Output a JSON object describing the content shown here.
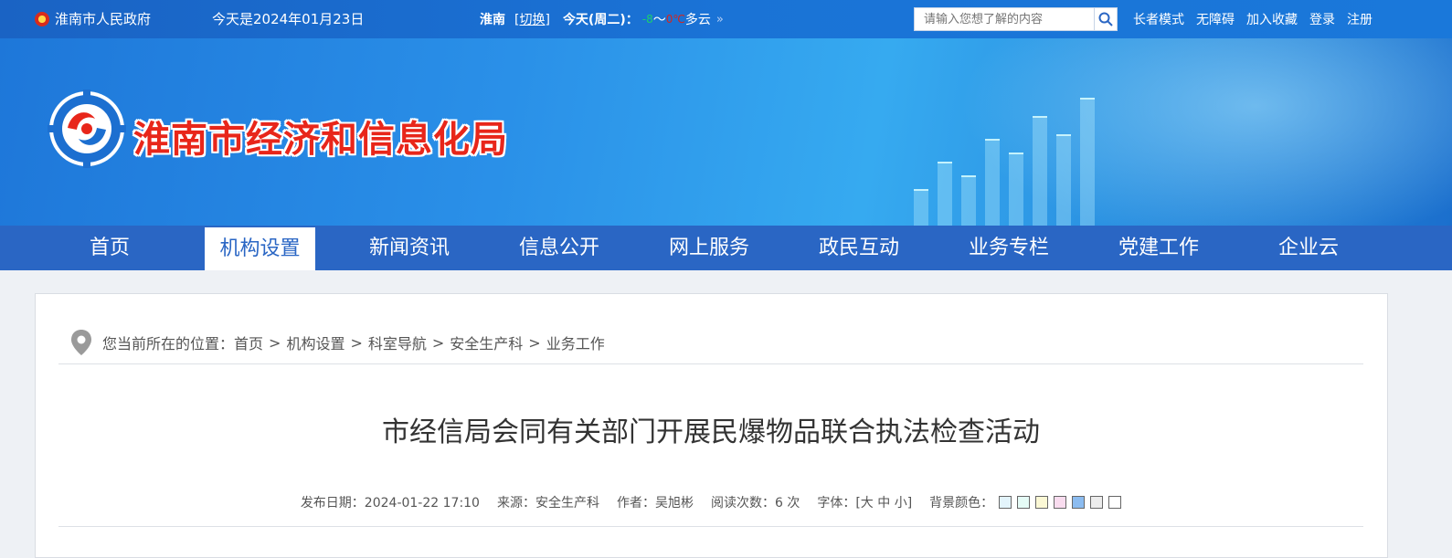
{
  "topbar": {
    "gov_name": "淮南市人民政府",
    "date_text": "今天是2024年01月23日",
    "city": "淮南",
    "switch_label": "[切换]",
    "today_label": "今天(周二)：",
    "temp_low": "-8",
    "temp_tilde": "〜",
    "temp_high": "0℃",
    "weather": "多云",
    "more_icon": "double-chevron-right",
    "search_placeholder": "请输入您想了解的内容",
    "links": [
      "长者模式",
      "无障碍",
      "加入收藏",
      "登录",
      "注册"
    ]
  },
  "banner": {
    "site_title": "淮南市经济和信息化局"
  },
  "nav": {
    "items": [
      "首页",
      "机构设置",
      "新闻资讯",
      "信息公开",
      "网上服务",
      "政民互动",
      "业务专栏",
      "党建工作",
      "企业云"
    ],
    "active": "机构设置"
  },
  "breadcrumb": {
    "prefix": "您当前所在的位置：",
    "items": [
      "首页",
      "机构设置",
      "科室导航",
      "安全生产科",
      "业务工作"
    ],
    "separator": ">"
  },
  "article": {
    "title": "市经信局会同有关部门开展民爆物品联合执法检查活动",
    "date": "发布日期：2024-01-22 17:10",
    "source": "来源：安全生产科",
    "author": "作者：吴旭彬",
    "reads": "阅读次数：6 次",
    "font_label": "字体：[大 中 小]",
    "bg_label": "背景颜色：",
    "bg_colors": [
      "#e3f4fb",
      "#e5fbf6",
      "#fbf8d5",
      "#f9dcef",
      "#8cbcf0",
      "#ececec",
      "#ffffff"
    ]
  },
  "colors": {
    "topbar": "#1a6bd0",
    "nav": "#2a66c4",
    "title_red": "#e8261a"
  }
}
